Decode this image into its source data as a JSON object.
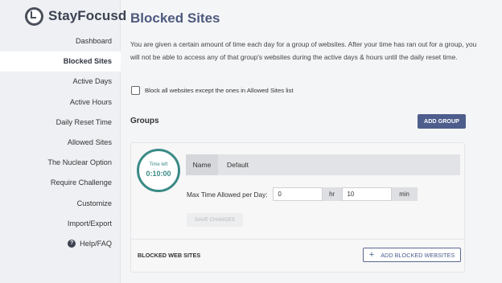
{
  "app": {
    "name": "StayFocusd"
  },
  "sidebar": {
    "items": [
      {
        "label": "Dashboard"
      },
      {
        "label": "Blocked Sites"
      },
      {
        "label": "Active Days"
      },
      {
        "label": "Active Hours"
      },
      {
        "label": "Daily Reset Time"
      },
      {
        "label": "Allowed Sites"
      },
      {
        "label": "The Nuclear Option"
      },
      {
        "label": "Require Challenge"
      },
      {
        "label": "Customize"
      },
      {
        "label": "Import/Export"
      },
      {
        "label": "Help/FAQ"
      }
    ],
    "active_index": 1,
    "help_icon": "question-circle-icon"
  },
  "main": {
    "title": "Blocked Sites",
    "description": "You are given a certain amount of time each day for a group of websites. After your time has ran out for a group, you will not be able to access any of that group's websites during the active days & hours until the daily reset time.",
    "block_all_label": "Block all websites except the ones in Allowed Sites list",
    "groups_title": "Groups",
    "add_group_label": "ADD GROUP",
    "group": {
      "timer_label": "Time left",
      "timer_value": "0:10:00",
      "name_label": "Name",
      "name_value": "Default",
      "max_time_label": "Max Time Allowed per Day:",
      "hours_value": "0",
      "hours_unit": "hr",
      "minutes_value": "10",
      "minutes_unit": "min",
      "save_label": "SAVE CHANGES",
      "blocked_label": "BLOCKED WEB SITES",
      "add_blocked_label": "ADD BLOCKED WEBSITES"
    }
  },
  "colors": {
    "accent": "#4d5d8c",
    "title": "#4e5a7e",
    "timer": "#3a8a86"
  }
}
